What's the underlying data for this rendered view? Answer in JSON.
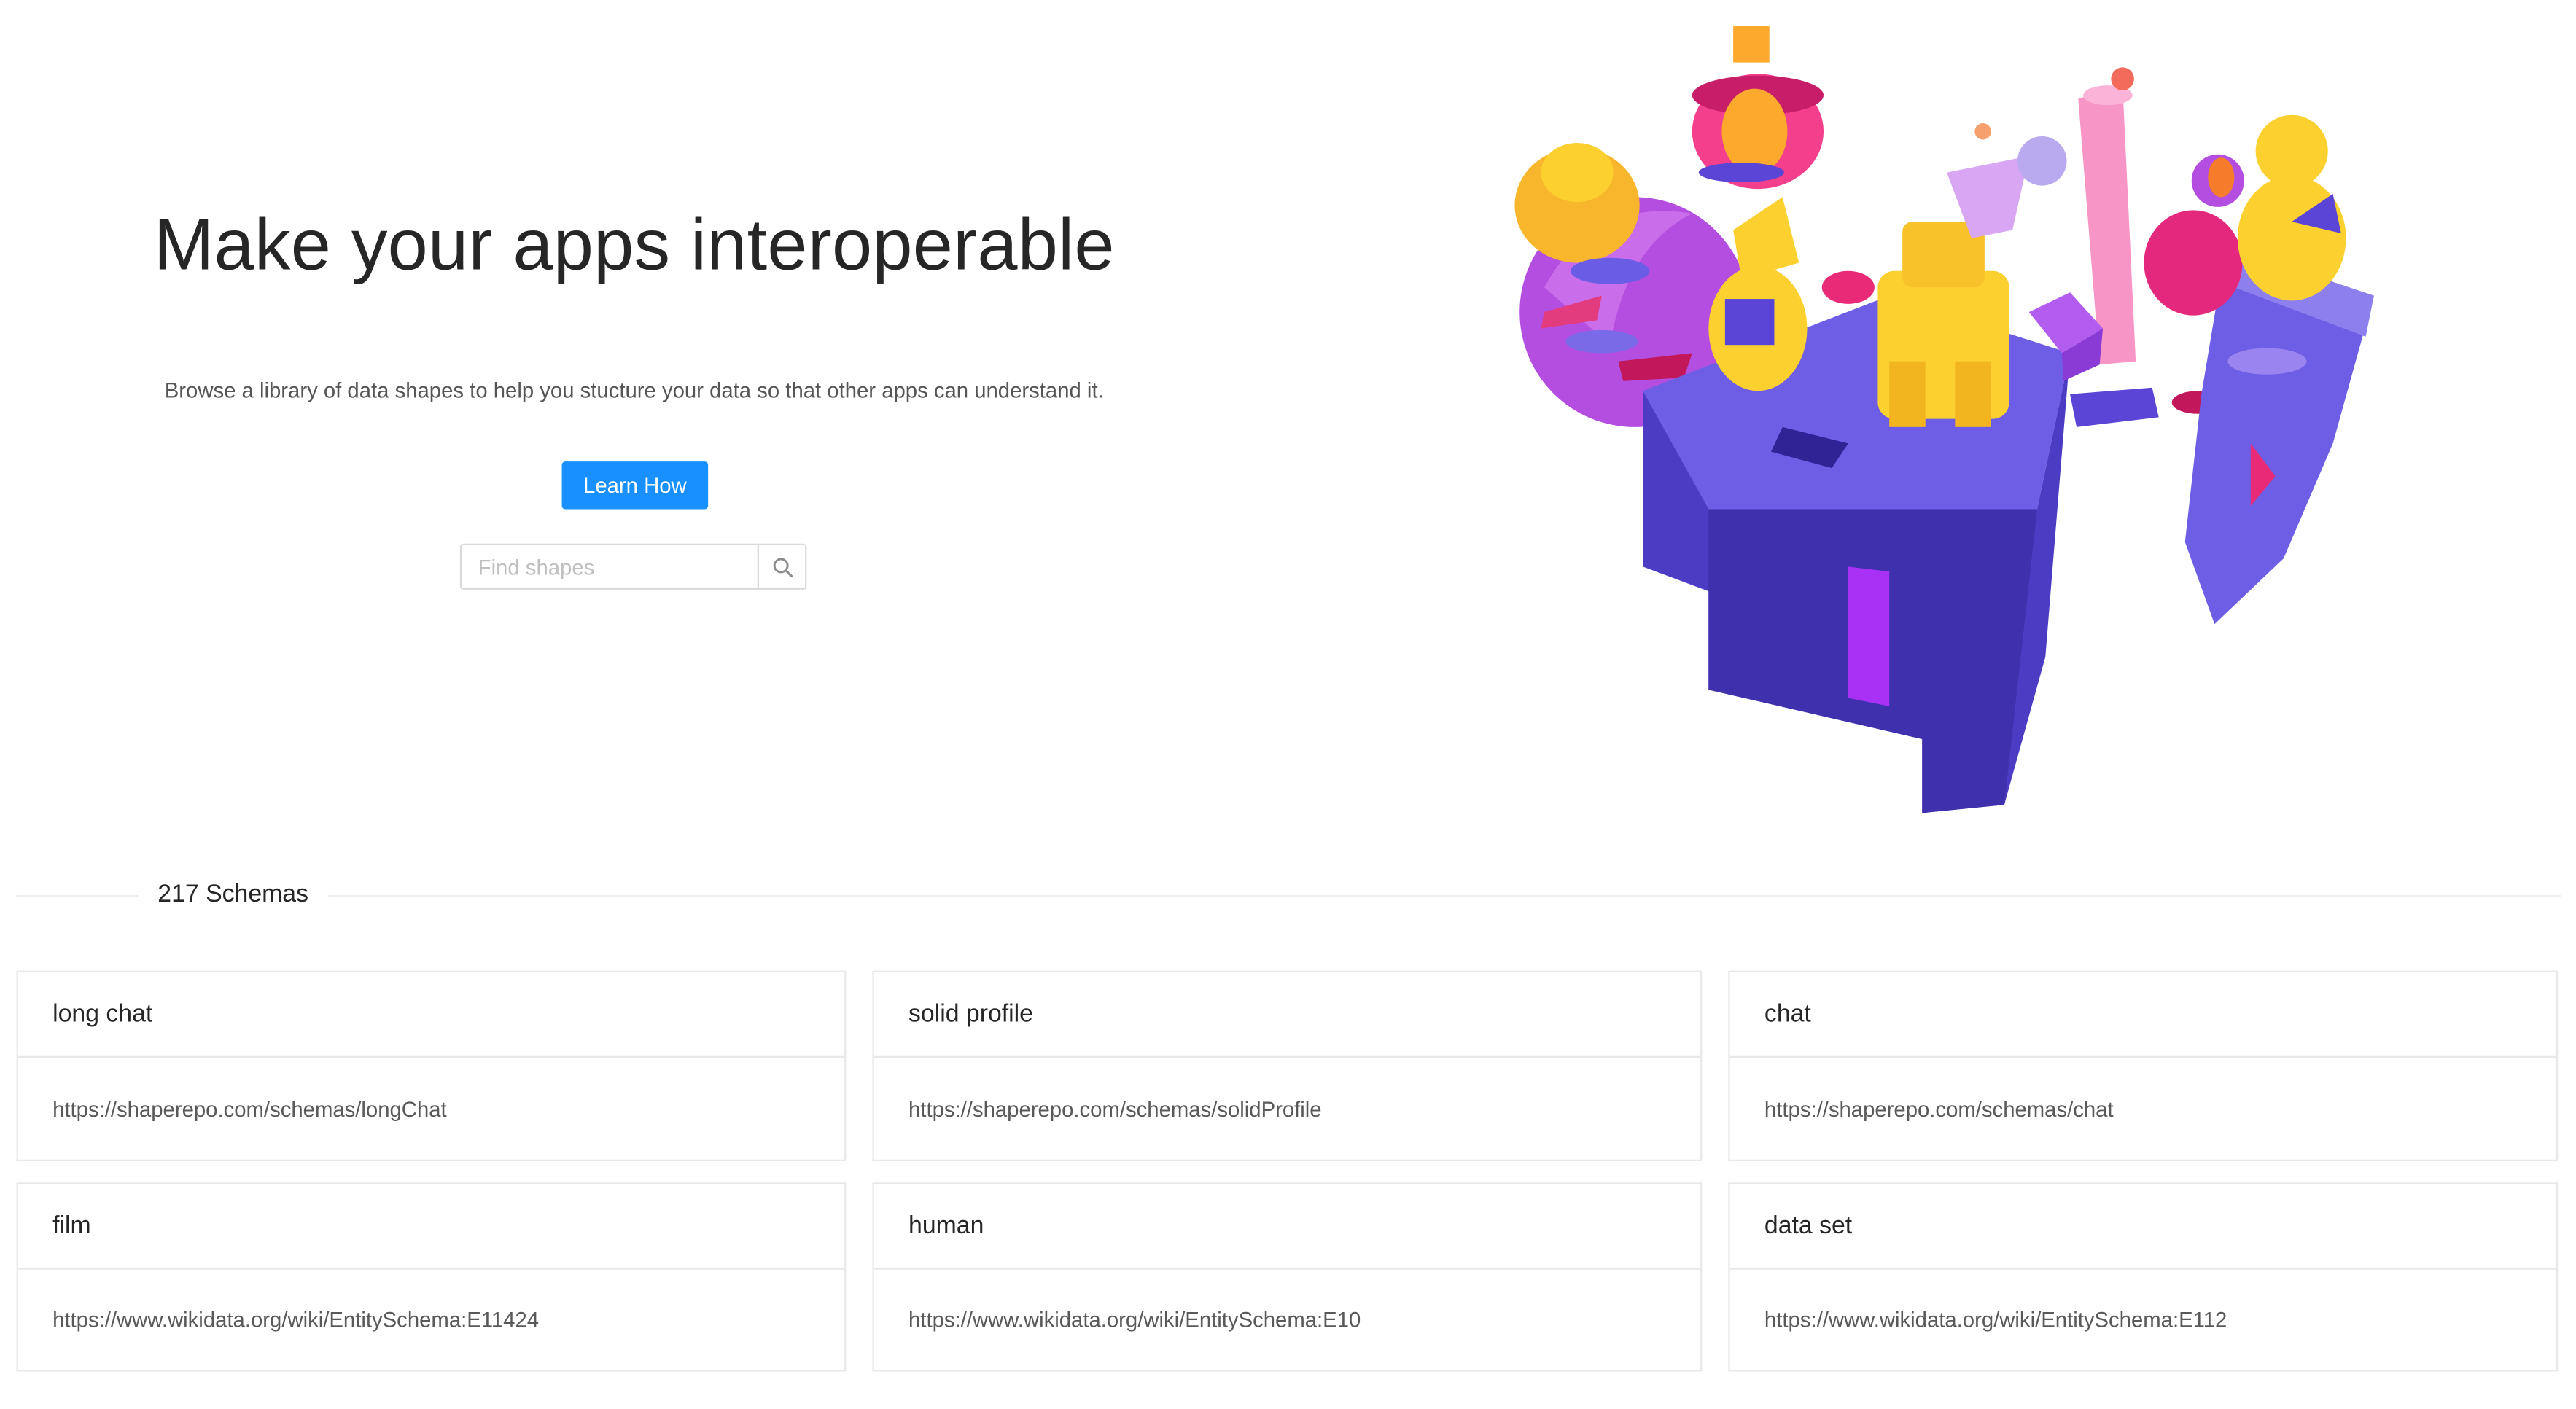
{
  "hero": {
    "title": "Make your apps interoperable",
    "subtitle": "Browse a library of data shapes to help you stucture your data so that other apps can understand it.",
    "cta_label": "Learn How",
    "search_placeholder": "Find shapes",
    "search_icon": "search-icon"
  },
  "colors": {
    "primary": "#1890ff",
    "illustration_purple": "#5b45d6",
    "illustration_yellow": "#fcd12f",
    "illustration_pink": "#f7419b"
  },
  "schemas": {
    "count_label": "217 Schemas",
    "items": [
      {
        "name": "long chat",
        "url": "https://shaperepo.com/schemas/longChat"
      },
      {
        "name": "solid profile",
        "url": "https://shaperepo.com/schemas/solidProfile"
      },
      {
        "name": "chat",
        "url": "https://shaperepo.com/schemas/chat"
      },
      {
        "name": "film",
        "url": "https://www.wikidata.org/wiki/EntitySchema:E11424"
      },
      {
        "name": "human",
        "url": "https://www.wikidata.org/wiki/EntitySchema:E10"
      },
      {
        "name": "data set",
        "url": "https://www.wikidata.org/wiki/EntitySchema:E112"
      }
    ]
  }
}
